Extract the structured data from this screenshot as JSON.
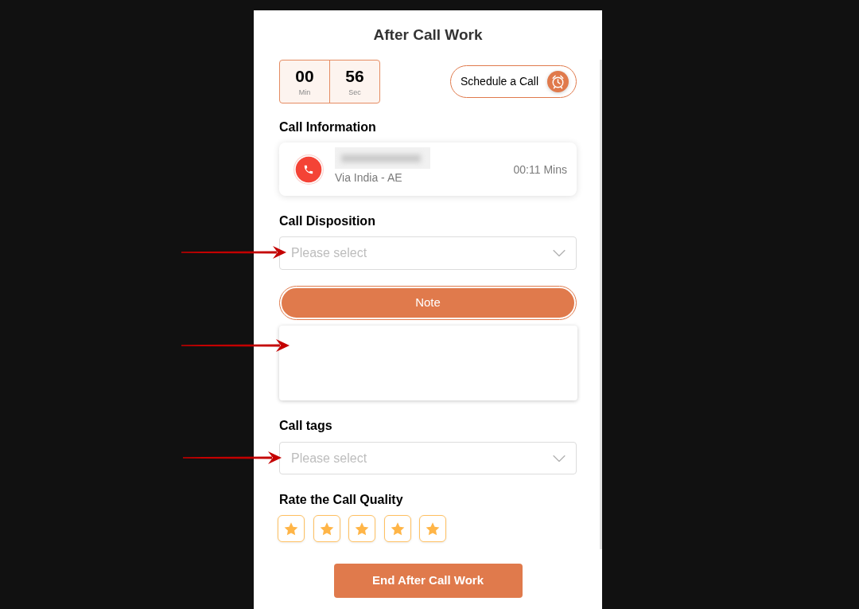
{
  "panel": {
    "title": "After Call Work"
  },
  "timer": [
    {
      "value": "00",
      "unit": "Min"
    },
    {
      "value": "56",
      "unit": "Sec"
    }
  ],
  "schedule_button": {
    "label": "Schedule a Call"
  },
  "call_information": {
    "heading": "Call Information",
    "detail": "Via India - AE",
    "duration": "00:11 Mins"
  },
  "call_disposition": {
    "label": "Call Disposition",
    "placeholder": "Please select"
  },
  "note": {
    "label": "Note"
  },
  "call_tags": {
    "label": "Call tags",
    "placeholder": "Please select"
  },
  "rating": {
    "label": "Rate the Call Quality",
    "stars": 5
  },
  "end_button": {
    "label": "End After Call Work"
  }
}
